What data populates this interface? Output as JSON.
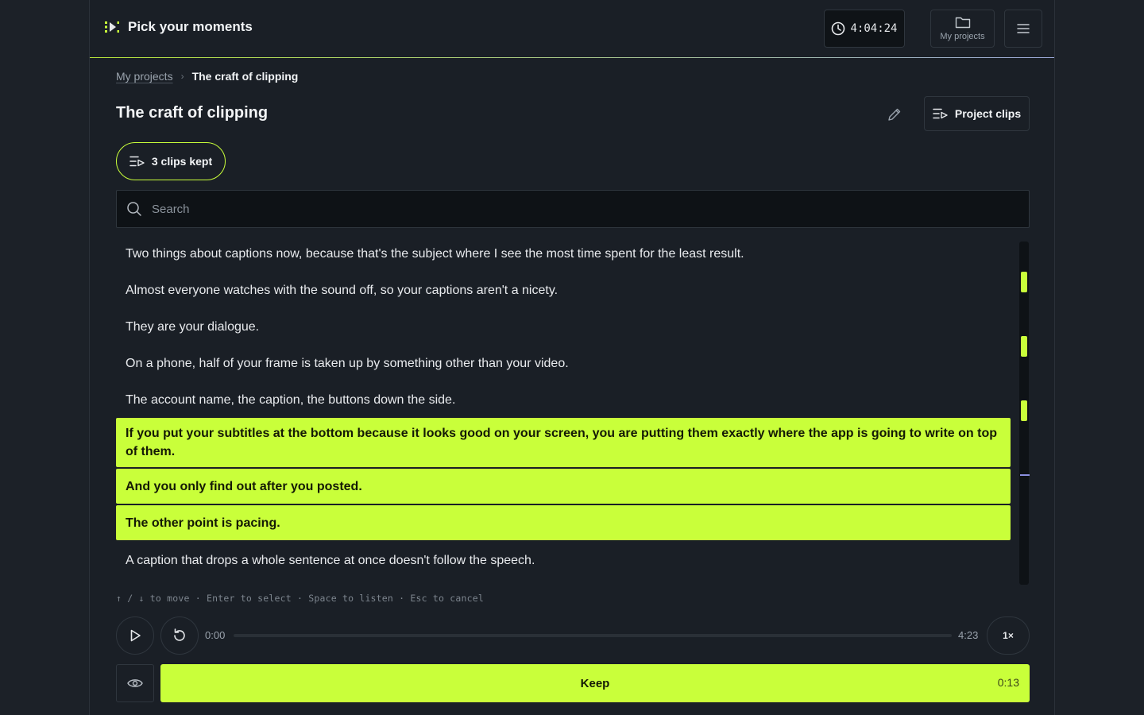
{
  "header": {
    "title": "Pick your moments",
    "timer": "4:04:24",
    "projects_label": "My projects"
  },
  "breadcrumb": {
    "parent": "My projects",
    "separator": "›",
    "current": "The craft of clipping"
  },
  "page": {
    "title": "The craft of clipping",
    "clips_button": "Project clips",
    "kept_pill": "3 clips kept"
  },
  "search": {
    "placeholder": "Search",
    "value": ""
  },
  "transcript": [
    {
      "text": "Two things about captions now, because that's the subject where I see the most time spent for the least result.",
      "kept": false
    },
    {
      "text": "Almost everyone watches with the sound off, so your captions aren't a nicety.",
      "kept": false
    },
    {
      "text": "They are your dialogue.",
      "kept": false
    },
    {
      "text": "On a phone, half of your frame is taken up by something other than your video.",
      "kept": false
    },
    {
      "text": "The account name, the caption, the buttons down the side.",
      "kept": false
    },
    {
      "text": "If you put your subtitles at the bottom because it looks good on your screen, you are putting them exactly where the app is going to write on top of them.",
      "kept": true
    },
    {
      "text": "And you only find out after you posted.",
      "kept": true
    },
    {
      "text": "The other point is pacing.",
      "kept": true
    },
    {
      "text": "A caption that drops a whole sentence at once doesn't follow the speech.",
      "kept": false
    }
  ],
  "hint": "↑ / ↓ to move · Enter to select · Space to listen · Esc to cancel",
  "player": {
    "current_time": "0:00",
    "duration": "4:23",
    "progress": 0,
    "speed": "1×"
  },
  "keep": {
    "label": "Keep",
    "duration": "0:13"
  },
  "colors": {
    "accent": "#c9ff3a",
    "background": "#1a1f26",
    "field": "#0e1216"
  }
}
